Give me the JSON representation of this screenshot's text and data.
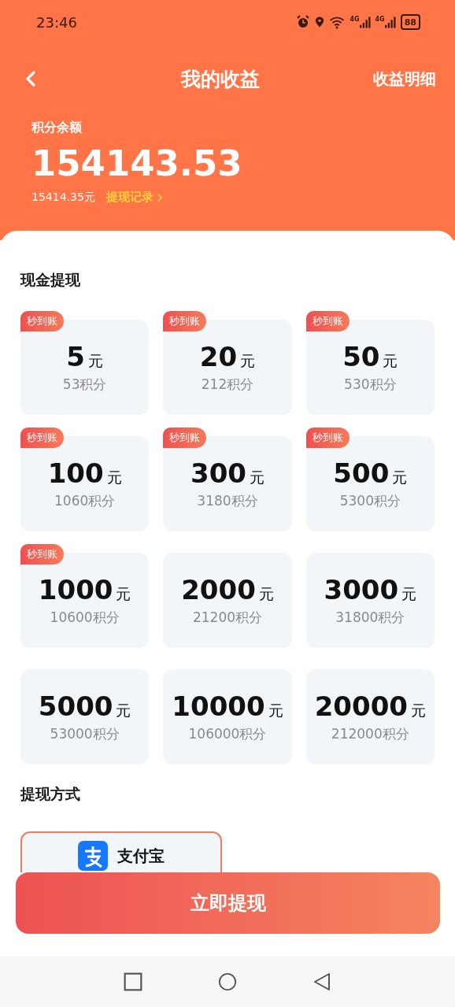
{
  "status_bar": {
    "time": "23:46",
    "network_1": "4G",
    "network_2": "4G",
    "battery": "88"
  },
  "nav": {
    "title": "我的收益",
    "action": "收益明细"
  },
  "balance": {
    "label": "积分余额",
    "points": "154143.53",
    "cash": "15414.35元",
    "record_link": "提现记录"
  },
  "cash_section": {
    "title": "现金提现",
    "options": [
      {
        "amount": "5",
        "unit": "元",
        "points": "53积分",
        "badge": "秒到账",
        "selected": false
      },
      {
        "amount": "20",
        "unit": "元",
        "points": "212积分",
        "badge": "秒到账",
        "selected": false
      },
      {
        "amount": "50",
        "unit": "元",
        "points": "530积分",
        "badge": "秒到账",
        "selected": false
      },
      {
        "amount": "100",
        "unit": "元",
        "points": "1060积分",
        "badge": "秒到账",
        "selected": false
      },
      {
        "amount": "300",
        "unit": "元",
        "points": "3180积分",
        "badge": "秒到账",
        "selected": false
      },
      {
        "amount": "500",
        "unit": "元",
        "points": "5300积分",
        "badge": "秒到账",
        "selected": false
      },
      {
        "amount": "1000",
        "unit": "元",
        "points": "10600积分",
        "badge": "秒到账",
        "selected": false
      },
      {
        "amount": "2000",
        "unit": "元",
        "points": "21200积分",
        "selected": false
      },
      {
        "amount": "3000",
        "unit": "元",
        "points": "31800积分",
        "selected": false
      },
      {
        "amount": "5000",
        "unit": "元",
        "points": "53000积分",
        "selected": false
      },
      {
        "amount": "10000",
        "unit": "元",
        "points": "106000积分",
        "selected": false
      },
      {
        "amount": "20000",
        "unit": "元",
        "points": "212000积分",
        "selected": false
      }
    ]
  },
  "method_section": {
    "title": "提现方式",
    "methods": [
      {
        "name": "支付宝",
        "selected": true
      }
    ]
  },
  "submit_button": "立即提现"
}
